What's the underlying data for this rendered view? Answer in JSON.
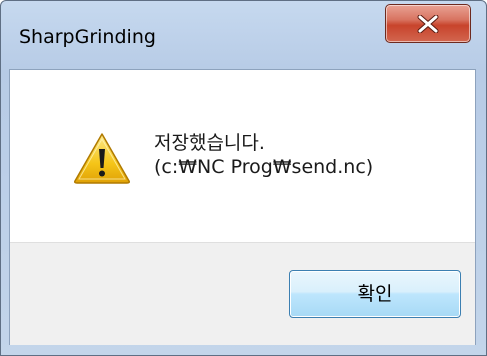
{
  "window": {
    "title": "SharpGrinding"
  },
  "dialog": {
    "message_line1": "저장했습니다.",
    "message_line2": "(c:₩NC Prog₩send.nc)",
    "icon": "warning-icon"
  },
  "buttons": {
    "ok_label": "확인",
    "close_icon": "close-icon"
  },
  "colors": {
    "close_button": "#c8442c",
    "ok_button_border": "#3c7fb1",
    "warning_yellow": "#f5c518"
  }
}
